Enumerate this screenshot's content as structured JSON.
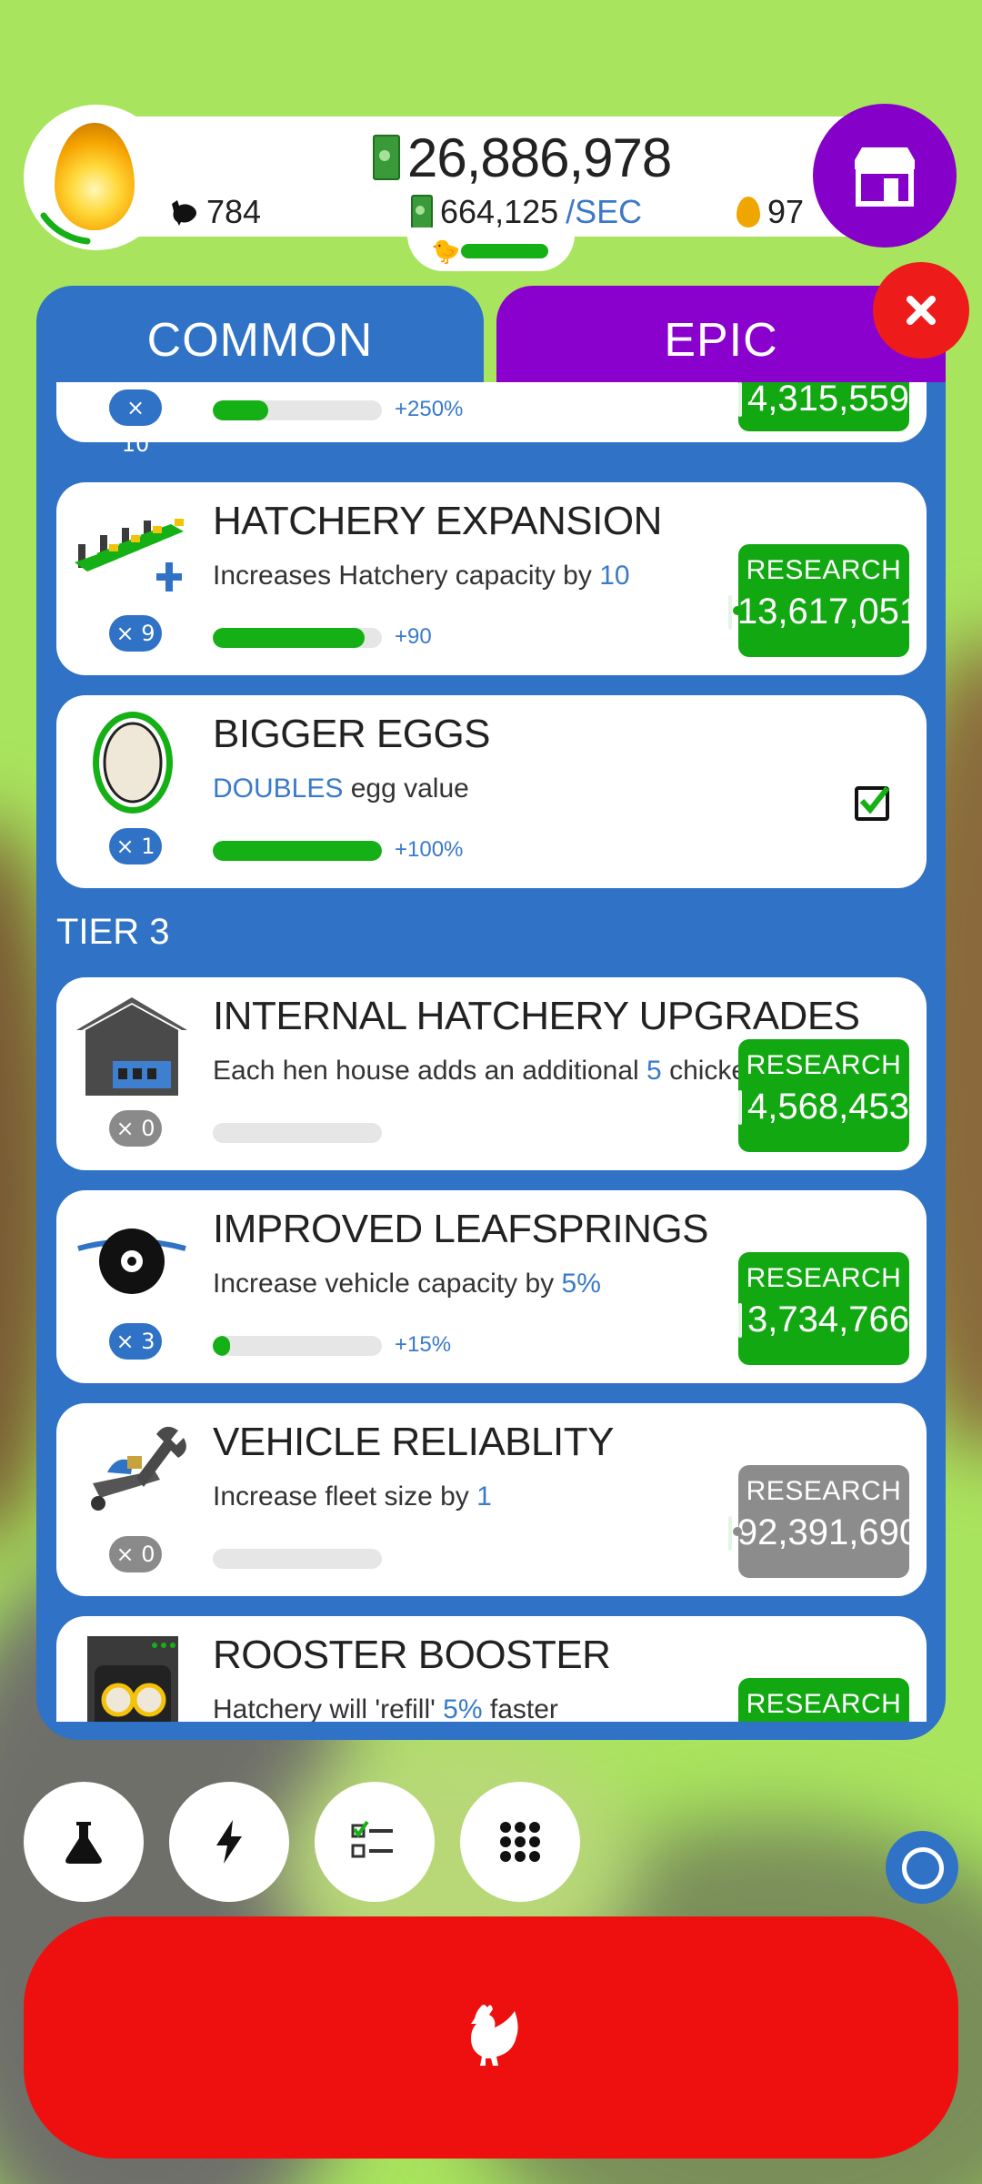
{
  "hud": {
    "money": "26,886,978",
    "chickens": "784",
    "rate_value": "664,125",
    "rate_unit": "/SEC",
    "golden_eggs": "97"
  },
  "tabs": {
    "common": "COMMON",
    "epic": "EPIC"
  },
  "cards": [
    {
      "level": "× 10",
      "progress": 0.33,
      "progress_label": "+250%",
      "price": "4,315,559"
    },
    {
      "title": "HATCHERY EXPANSION",
      "desc_prefix": "Increases Hatchery capacity by ",
      "desc_value": "10",
      "desc_suffix": "",
      "level": "× 9",
      "progress": 0.9,
      "progress_label": "+90",
      "button": "RESEARCH",
      "price": "13,617,051"
    },
    {
      "title": "BIGGER EGGS",
      "desc_prefix": "",
      "desc_value": "DOUBLES",
      "desc_suffix": " egg value",
      "level": "× 1",
      "progress": 1.0,
      "progress_label": "+100%"
    },
    {
      "title": "INTERNAL HATCHERY UPGRADES",
      "desc_prefix": "Each hen house adds an additional ",
      "desc_value": "5",
      "desc_suffix": " chickens/min",
      "level": "× 0",
      "progress": 0,
      "progress_label": "",
      "button": "RESEARCH",
      "price": "4,568,453"
    },
    {
      "title": "IMPROVED LEAFSPRINGS",
      "desc_prefix": "Increase vehicle capacity by ",
      "desc_value": "5%",
      "desc_suffix": "",
      "level": "× 3",
      "progress": 0.1,
      "progress_label": "+15%",
      "button": "RESEARCH",
      "price": "3,734,766"
    },
    {
      "title": "VEHICLE RELIABLITY",
      "desc_prefix": "Increase fleet size by ",
      "desc_value": "1",
      "desc_suffix": "",
      "level": "× 0",
      "progress": 0,
      "progress_label": "",
      "button": "RESEARCH",
      "price": "92,391,690"
    },
    {
      "title": "ROOSTER BOOSTER",
      "desc_prefix": "Hatchery will 'refill' ",
      "desc_value": "5%",
      "desc_suffix": " faster",
      "button": "RESEARCH"
    }
  ],
  "tier": "TIER 3",
  "colors": {
    "green": "#15b015",
    "blue": "#2f72c6",
    "purple": "#8500c9",
    "red": "#ee0f0f"
  },
  "icons": [
    "flask-icon",
    "lightning-icon",
    "checklist-icon",
    "grid-icon",
    "chicken-icon",
    "shop-icon",
    "close-icon"
  ]
}
